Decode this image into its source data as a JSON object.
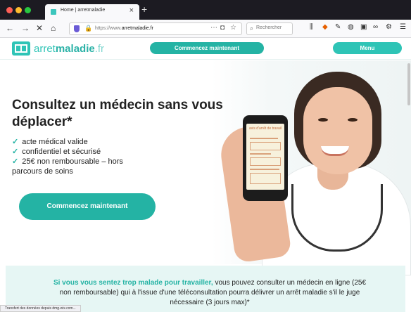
{
  "browser": {
    "tab_title": "Home | arretmaladie",
    "tab_close": "×",
    "new_tab": "+",
    "url_prefix": "https://www.",
    "url_domain": "arretmaladie.fr",
    "search_placeholder": "Rechercher",
    "status_text": "Transfert des données depuis dmg.wix.com..."
  },
  "header": {
    "logo_light": "arret",
    "logo_bold": "maladie",
    "logo_tld": ".fr",
    "cta_label": "Commencez maintenant",
    "menu_label": "Menu"
  },
  "hero": {
    "heading": "Consultez un médecin sans vous déplacer*",
    "bullets": [
      "acte médical valide",
      "confidentiel et sécurisé",
      "25€ non remboursable – hors parcours de soins"
    ],
    "cta_label": "Commencez maintenant",
    "phone_doc_title": "avis d'arrêt de travail"
  },
  "info": {
    "highlight": "Si vous vous sentez trop malade pour travailler,",
    "rest": " vous pouvez consulter un médecin en ligne (25€ non remboursable) qui à l'issue d'une téléconsultation pourra délivrer un arrêt maladie s'il le juge nécessaire (3 jours max)*"
  },
  "colors": {
    "brand": "#2ec4b6",
    "brand_dark": "#24b3a4",
    "info_bg": "#e6f6f4"
  },
  "icons": [
    "back-arrow-icon",
    "forward-arrow-icon",
    "close-icon",
    "home-icon",
    "shield-icon",
    "lock-icon",
    "more-icon",
    "pocket-icon",
    "bookmark-star-icon",
    "search-icon",
    "library-icon",
    "extension-icon",
    "pen-icon",
    "account-icon",
    "screenshot-icon",
    "link-icon",
    "settings-icon",
    "hamburger-menu-icon",
    "checkmark-icon"
  ]
}
